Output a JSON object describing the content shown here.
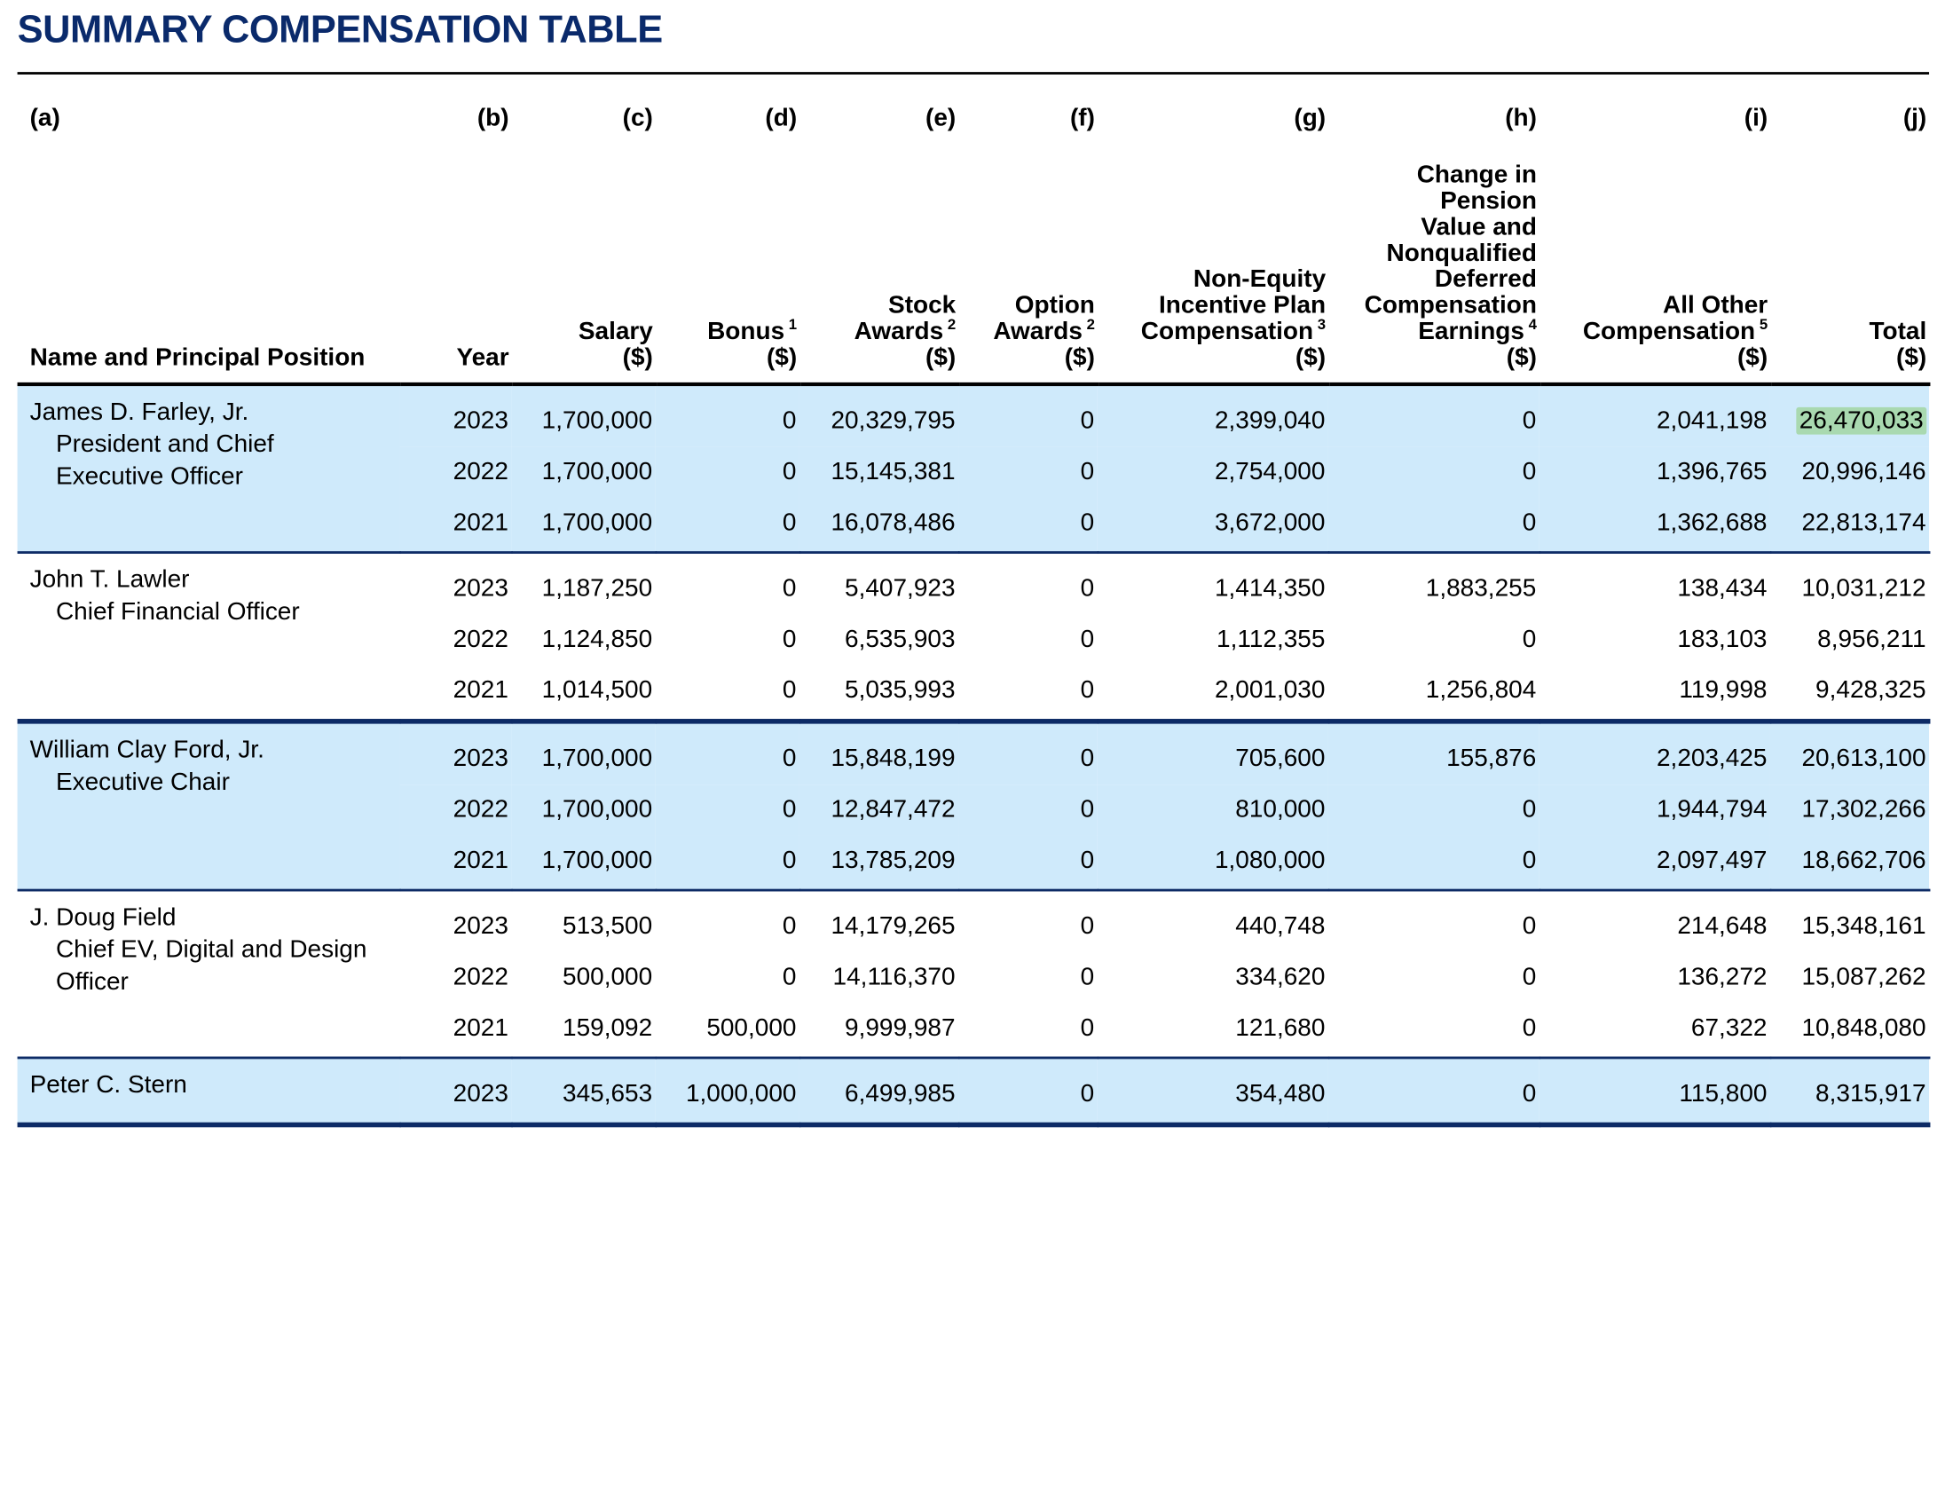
{
  "title": "SUMMARY COMPENSATION TABLE",
  "columns": [
    {
      "letter": "(a)",
      "label_lines": [
        "Name and Principal Position"
      ],
      "footnote": ""
    },
    {
      "letter": "(b)",
      "label_lines": [
        "Year"
      ],
      "footnote": ""
    },
    {
      "letter": "(c)",
      "label_lines": [
        "Salary",
        "($)"
      ],
      "footnote": ""
    },
    {
      "letter": "(d)",
      "label_lines": [
        "Bonus",
        "($)"
      ],
      "footnote": "1"
    },
    {
      "letter": "(e)",
      "label_lines": [
        "Stock",
        "Awards",
        "($)"
      ],
      "footnote": "2"
    },
    {
      "letter": "(f)",
      "label_lines": [
        "Option",
        "Awards",
        "($)"
      ],
      "footnote": "2"
    },
    {
      "letter": "(g)",
      "label_lines": [
        "Non-Equity",
        "Incentive Plan",
        "Compensation",
        "($)"
      ],
      "footnote": "3"
    },
    {
      "letter": "(h)",
      "label_lines": [
        "Change in",
        "Pension",
        "Value and",
        "Nonqualified",
        "Deferred",
        "Compensation",
        "Earnings",
        "($)"
      ],
      "footnote": "4"
    },
    {
      "letter": "(i)",
      "label_lines": [
        "All Other",
        "Compensation",
        "($)"
      ],
      "footnote": "5"
    },
    {
      "letter": "(j)",
      "label_lines": [
        "Total",
        "($)"
      ],
      "footnote": ""
    }
  ],
  "executives": [
    {
      "name": "James D. Farley, Jr.",
      "position_lines": [
        "President and Chief",
        "Executive Officer"
      ],
      "shaded": true,
      "rows": [
        {
          "year": "2023",
          "salary": "1,700,000",
          "bonus": "0",
          "stock": "20,329,795",
          "option": "0",
          "non_equity": "2,399,040",
          "pension": "0",
          "other": "2,041,198",
          "total": "26,470,033"
        },
        {
          "year": "2022",
          "salary": "1,700,000",
          "bonus": "0",
          "stock": "15,145,381",
          "option": "0",
          "non_equity": "2,754,000",
          "pension": "0",
          "other": "1,396,765",
          "total": "20,996,146"
        },
        {
          "year": "2021",
          "salary": "1,700,000",
          "bonus": "0",
          "stock": "16,078,486",
          "option": "0",
          "non_equity": "3,672,000",
          "pension": "0",
          "other": "1,362,688",
          "total": "22,813,174"
        }
      ]
    },
    {
      "name": "John T. Lawler",
      "position_lines": [
        "Chief Financial Officer"
      ],
      "shaded": false,
      "rows": [
        {
          "year": "2023",
          "salary": "1,187,250",
          "bonus": "0",
          "stock": "5,407,923",
          "option": "0",
          "non_equity": "1,414,350",
          "pension": "1,883,255",
          "other": "138,434",
          "total": "10,031,212"
        },
        {
          "year": "2022",
          "salary": "1,124,850",
          "bonus": "0",
          "stock": "6,535,903",
          "option": "0",
          "non_equity": "1,112,355",
          "pension": "0",
          "other": "183,103",
          "total": "8,956,211"
        },
        {
          "year": "2021",
          "salary": "1,014,500",
          "bonus": "0",
          "stock": "5,035,993",
          "option": "0",
          "non_equity": "2,001,030",
          "pension": "1,256,804",
          "other": "119,998",
          "total": "9,428,325"
        }
      ]
    },
    {
      "name": "William Clay Ford, Jr.",
      "position_lines": [
        "Executive Chair"
      ],
      "shaded": true,
      "rows": [
        {
          "year": "2023",
          "salary": "1,700,000",
          "bonus": "0",
          "stock": "15,848,199",
          "option": "0",
          "non_equity": "705,600",
          "pension": "155,876",
          "other": "2,203,425",
          "total": "20,613,100"
        },
        {
          "year": "2022",
          "salary": "1,700,000",
          "bonus": "0",
          "stock": "12,847,472",
          "option": "0",
          "non_equity": "810,000",
          "pension": "0",
          "other": "1,944,794",
          "total": "17,302,266"
        },
        {
          "year": "2021",
          "salary": "1,700,000",
          "bonus": "0",
          "stock": "13,785,209",
          "option": "0",
          "non_equity": "1,080,000",
          "pension": "0",
          "other": "2,097,497",
          "total": "18,662,706"
        }
      ]
    },
    {
      "name": "J. Doug Field",
      "position_lines": [
        "Chief EV, Digital and Design",
        "Officer"
      ],
      "shaded": false,
      "rows": [
        {
          "year": "2023",
          "salary": "513,500",
          "bonus": "0",
          "stock": "14,179,265",
          "option": "0",
          "non_equity": "440,748",
          "pension": "0",
          "other": "214,648",
          "total": "15,348,161"
        },
        {
          "year": "2022",
          "salary": "500,000",
          "bonus": "0",
          "stock": "14,116,370",
          "option": "0",
          "non_equity": "334,620",
          "pension": "0",
          "other": "136,272",
          "total": "15,087,262"
        },
        {
          "year": "2021",
          "salary": "159,092",
          "bonus": "500,000",
          "stock": "9,999,987",
          "option": "0",
          "non_equity": "121,680",
          "pension": "0",
          "other": "67,322",
          "total": "10,848,080"
        }
      ]
    },
    {
      "name": "Peter C. Stern",
      "position_lines": [],
      "shaded": true,
      "rows": [
        {
          "year": "2023",
          "salary": "345,653",
          "bonus": "1,000,000",
          "stock": "6,499,985",
          "option": "0",
          "non_equity": "354,480",
          "pension": "0",
          "other": "115,800",
          "total": "8,315,917"
        }
      ]
    }
  ],
  "highlight": {
    "exec_index": 0,
    "row_index": 0,
    "field": "total",
    "color": "#a9d9b0"
  },
  "colors": {
    "title": "#0a2a6b",
    "shade": "#cfeafb",
    "rule": "#0d2b66"
  }
}
